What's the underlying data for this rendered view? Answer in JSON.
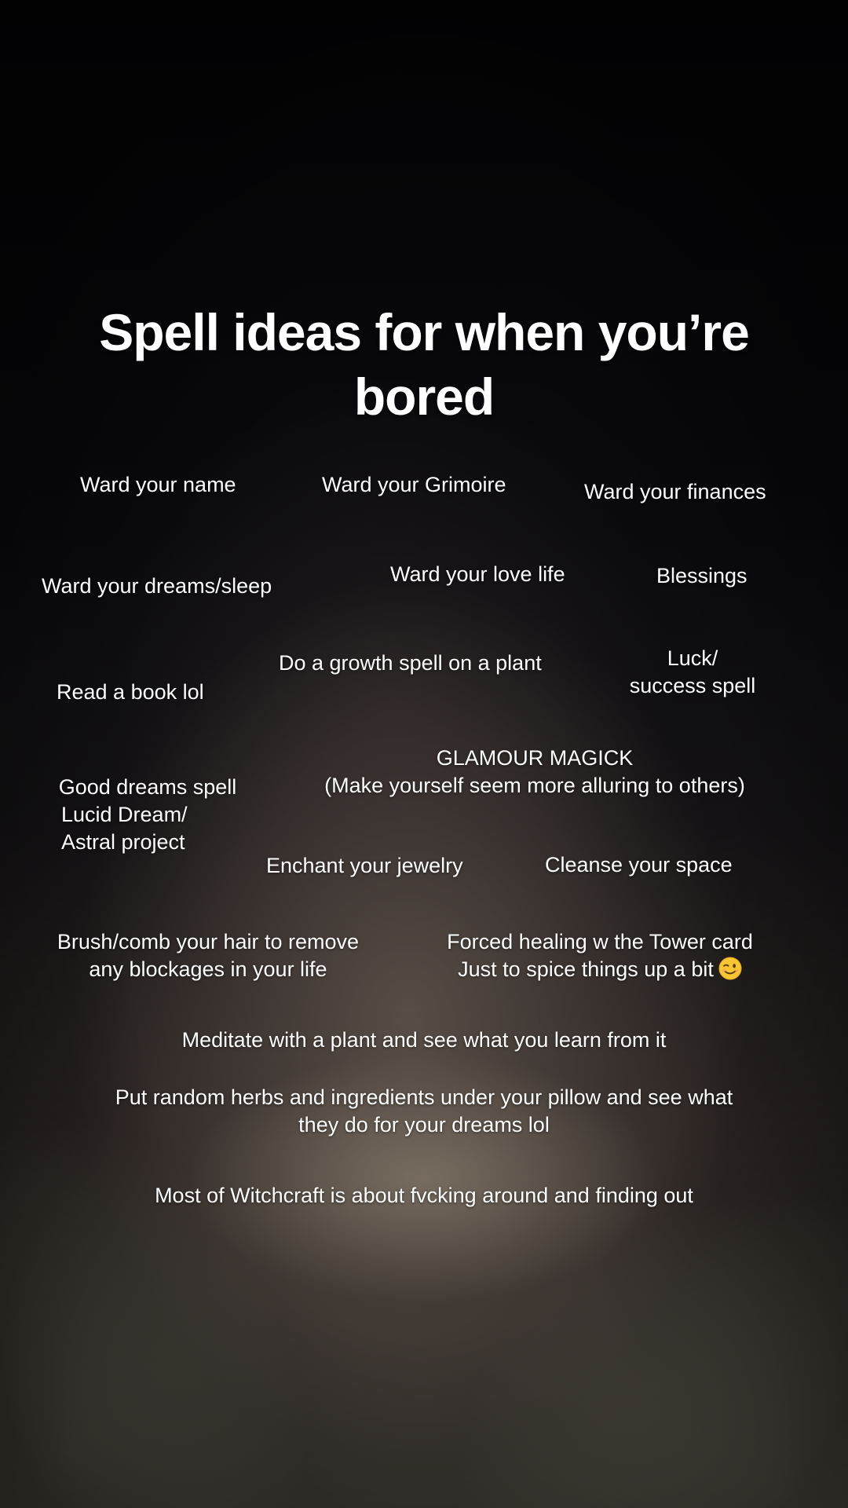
{
  "title": "Spell ideas for when you’re bored",
  "notes": {
    "ward_name": "Ward your name",
    "ward_grimoire": "Ward your Grimoire",
    "ward_finances": "Ward your finances",
    "ward_dreams": "Ward your dreams/sleep",
    "ward_love": "Ward your love life",
    "blessings": "Blessings",
    "growth_spell": "Do a growth spell on a plant",
    "luck_line1": "Luck/",
    "luck_line2": "success spell",
    "read_book": "Read a book lol",
    "glamour_line1": "GLAMOUR MAGICK",
    "glamour_line2": "(Make yourself seem more alluring to others)",
    "dreams_line1": "Good dreams spell",
    "dreams_line2": "Lucid Dream/",
    "dreams_line3": "Astral project",
    "enchant_jewelry": "Enchant your jewelry",
    "cleanse_space": "Cleanse your space",
    "brush_line1": "Brush/comb your hair to remove",
    "brush_line2": "any blockages in your life",
    "tower_line1": "Forced healing w the Tower card",
    "tower_line2": "Just to spice things up a bit",
    "meditate": "Meditate with a plant and see what you learn from it",
    "herbs_line1": "Put random herbs and ingredients under your pillow and see what",
    "herbs_line2": "they do for your dreams lol",
    "witchcraft": "Most of Witchcraft is about fvcking around and finding out"
  },
  "icons": {
    "winking_face": "winking-face-emoji"
  }
}
